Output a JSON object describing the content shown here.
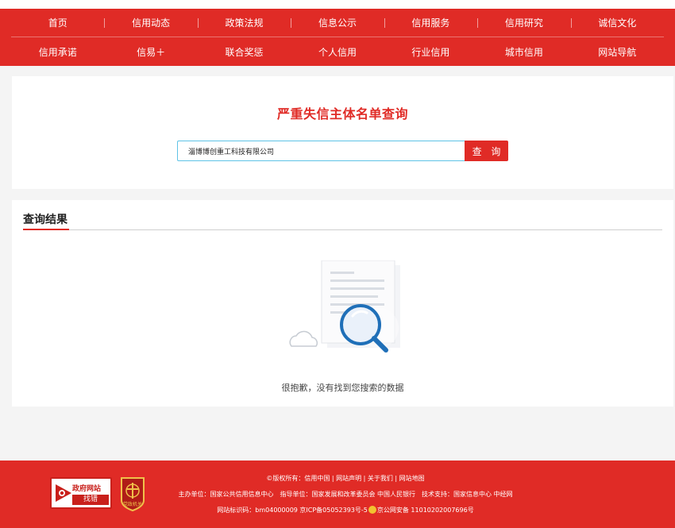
{
  "nav": {
    "row1": [
      "首页",
      "信用动态",
      "政策法规",
      "信息公示",
      "信用服务",
      "信用研究",
      "诚信文化"
    ],
    "row2": [
      "信用承诺",
      "信易＋",
      "联合奖惩",
      "个人信用",
      "行业信用",
      "城市信用",
      "网站导航"
    ]
  },
  "search": {
    "title": "严重失信主体名单查询",
    "value": "淄博博创重工科技有限公司",
    "button_label": "查 询"
  },
  "result": {
    "title": "查询结果",
    "empty_text": "很抱歉，没有找到您搜索的数据"
  },
  "footer": {
    "gov_badge_line1": "政府网站",
    "gov_badge_line2": "找错",
    "party_badge_label": "党政机关",
    "copyright": "©版权所有：信用中国 | 网站声明 | 关于我们 | 网站地图",
    "sponsors": "主办单位：国家公共信用信息中心　指导单位：国家发展和改革委员会 中国人民银行　技术支持：国家信息中心 中经网",
    "identifier_prefix": "网站标识码：bm04000009 京ICP备05052393号-5",
    "identifier_suffix": "京公网安备 11010202007696号"
  },
  "colors": {
    "brand_red": "#e02b26",
    "input_border": "#5fc3e6",
    "illustration_blue": "#1f6fb8"
  }
}
